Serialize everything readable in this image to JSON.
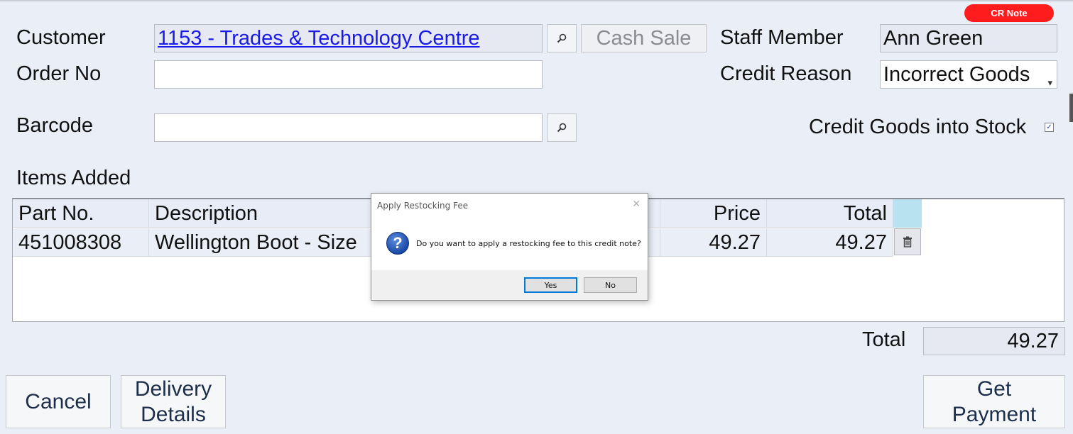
{
  "badge": "CR Note",
  "form": {
    "customer_label": "Customer",
    "customer_value": "1153 - Trades & Technology Centre",
    "cash_sale_label": "Cash Sale",
    "staff_label": "Staff Member",
    "staff_value": "Ann Green",
    "order_label": "Order No",
    "order_value": "",
    "credit_reason_label": "Credit Reason",
    "credit_reason_value": "Incorrect Goods",
    "barcode_label": "Barcode",
    "barcode_value": "",
    "credit_stock_label": "Credit Goods into Stock",
    "credit_stock_checked": true,
    "items_label": "Items Added"
  },
  "grid": {
    "columns": [
      "Part No.",
      "Description",
      "Price",
      "Total"
    ],
    "rows": [
      {
        "part_no": "451008308",
        "description": "Wellington Boot - Size",
        "price": "49.27",
        "total": "49.27"
      }
    ]
  },
  "summary": {
    "total_label": "Total",
    "total_value": "49.27"
  },
  "buttons": {
    "cancel": "Cancel",
    "delivery_line1": "Delivery",
    "delivery_line2": "Details",
    "payment_line1": "Get",
    "payment_line2": "Payment"
  },
  "dialog": {
    "title": "Apply Restocking Fee",
    "message": "Do you want to apply a restocking fee to this credit note?",
    "yes": "Yes",
    "no": "No"
  },
  "icons": {
    "search": "magnifier-icon",
    "trash": "trash-icon",
    "question": "question-icon"
  },
  "colors": {
    "badge": "#ff1c1c",
    "link": "#1a1ae6",
    "accent_header": "#b9e2f0"
  }
}
